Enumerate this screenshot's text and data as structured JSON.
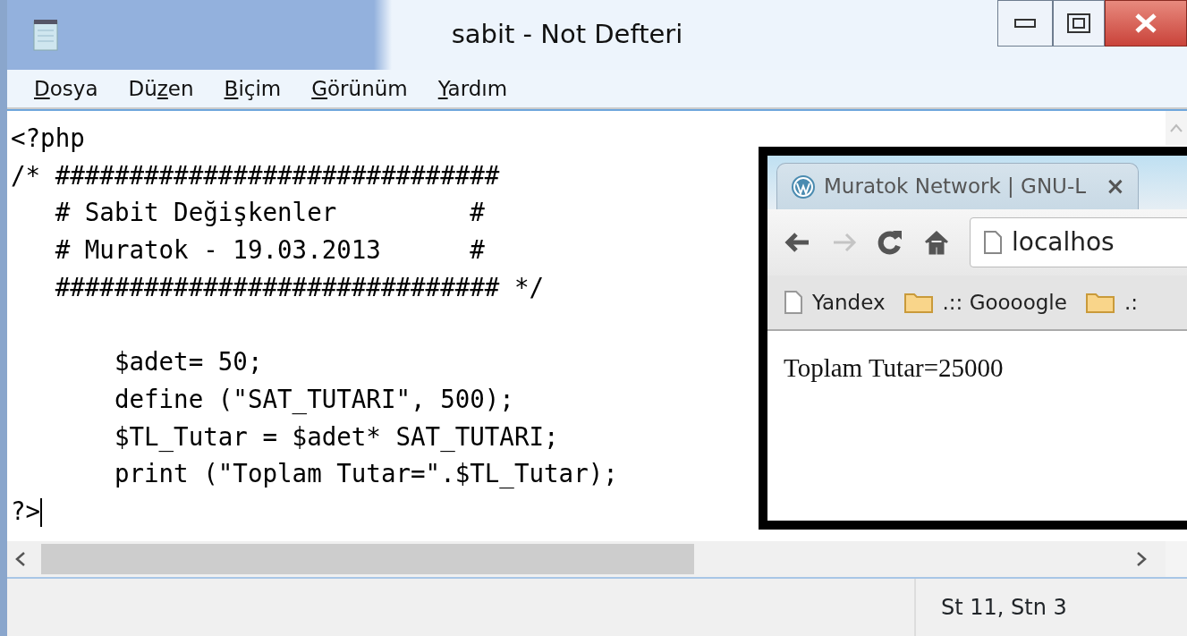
{
  "window": {
    "title": "sabit - Not Defteri"
  },
  "menu": [
    {
      "key": "D",
      "after": "osya"
    },
    {
      "before": "Dü",
      "key": "z",
      "after": "en"
    },
    {
      "key": "B",
      "after": "içim"
    },
    {
      "key": "G",
      "after": "örünüm"
    },
    {
      "key": "Y",
      "after": "ardım"
    }
  ],
  "editor": {
    "text": "<?php\n/* ##############################\n   # Sabit Değişkenler         #\n   # Muratok - 19.03.2013      #\n   ############################## */\n\n       $adet= 50;\n       define (\"SAT_TUTARI\", 500);\n       $TL_Tutar = $adet* SAT_TUTARI;\n       print (\"Toplam Tutar=\".$TL_Tutar);\n?>"
  },
  "browser": {
    "tab": {
      "title": "Muratok Network | GNU-L",
      "close": "×"
    },
    "nav_buttons": [
      {
        "kind": "back",
        "disabled": false
      },
      {
        "kind": "forward",
        "disabled": true
      },
      {
        "kind": "reload",
        "disabled": false
      },
      {
        "kind": "home",
        "disabled": false
      }
    ],
    "address": "localhos",
    "bookmarks": [
      {
        "kind": "page",
        "label": "Yandex"
      },
      {
        "kind": "folder",
        "label": ".:: Goooogle"
      },
      {
        "kind": "folder",
        "label": ".:"
      }
    ],
    "content": "Toplam Tutar=25000"
  },
  "status_bar": {
    "position": "St 11, Stn 3"
  }
}
